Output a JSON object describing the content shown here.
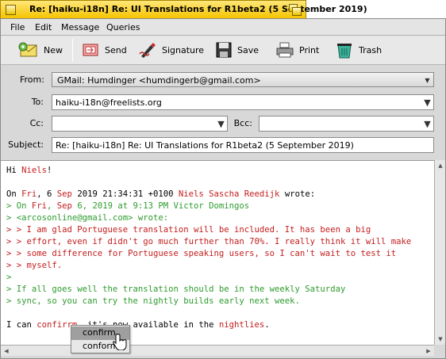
{
  "window": {
    "title": "Re: [haiku-i18n] Re: UI Translations for R1beta2 (5 September 2019)"
  },
  "menubar": {
    "items": [
      "File",
      "Edit",
      "Message",
      "Queries"
    ]
  },
  "toolbar": {
    "new_label": "New",
    "send_label": "Send",
    "signature_label": "Signature",
    "save_label": "Save",
    "print_label": "Print",
    "trash_label": "Trash"
  },
  "fields": {
    "from_label": "From:",
    "from_value": "GMail:  Humdinger <humdingerb@gmail.com>",
    "to_label": "To:",
    "to_value": "haiku-i18n@freelists.org",
    "cc_label": "Cc:",
    "cc_value": "",
    "bcc_label": "Bcc:",
    "bcc_value": "",
    "subject_label": "Subject:",
    "subject_value": "Re: [haiku-i18n] Re: UI Translations for R1beta2 (5 September 2019)"
  },
  "body": {
    "l1a": "Hi ",
    "l1b": "Niels",
    "l1c": "!",
    "l2a": "On ",
    "l2b": "Fri",
    "l2c": ", 6 ",
    "l2d": "Sep",
    "l2e": " 2019 21:34:31 +0100 ",
    "l2f": "Niels Sascha Reedijk",
    "l2g": " wrote:",
    "l3a": "> On ",
    "l3b": "Fri",
    "l3c": ", ",
    "l3d": "Sep",
    "l3e": " 6, 2019 at 9:13 PM Victor Domingos",
    "l4": "> <arcosonline@gmail.com> wrote:",
    "l5": "> > I am glad Portuguese translation will be included. It has been a big",
    "l6": "> > effort, even if didn't go much further than 70%. I really think it will make",
    "l7": "> > some difference for Portuguese speaking users, so I can't wait to test it",
    "l8": "> > myself.",
    "l9": ">",
    "l10": "> If all goes well the translation should be in the weekly Saturday",
    "l11": "> sync, so you can try the nightly builds early next week.",
    "l12a": "I can ",
    "l12b": "confirrm",
    "l12c": ", it's now available in the ",
    "l12d": "nightlies",
    "l12e": "."
  },
  "popup": {
    "items": [
      "confirm",
      "conform"
    ],
    "selected": "confirm"
  },
  "colors": {
    "tab": "#f5c400",
    "quote_level1": "#2e9b2e",
    "quote_level2": "#c41d1d",
    "misspelled": "#c41d1d"
  }
}
